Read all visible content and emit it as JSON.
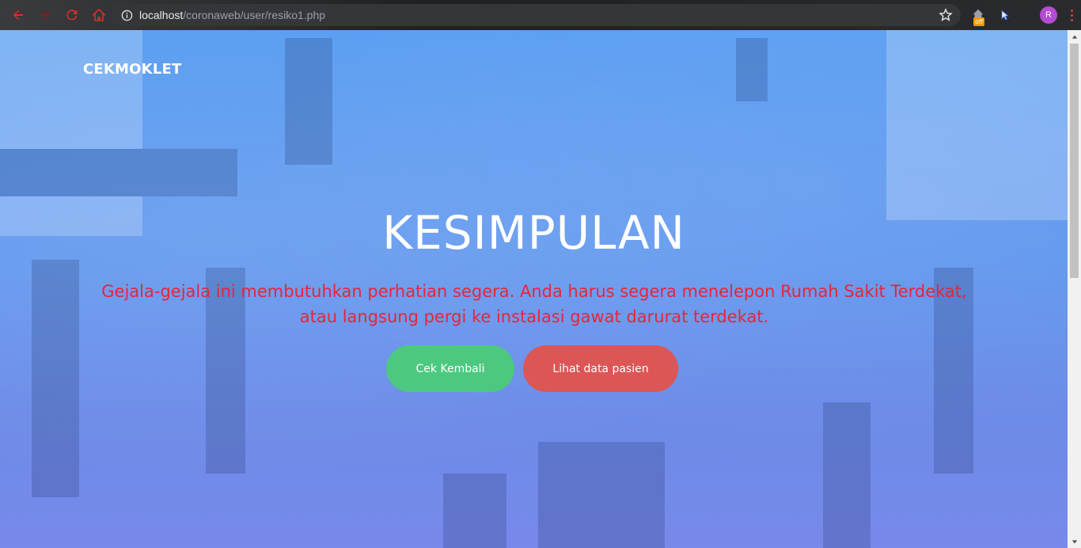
{
  "browser": {
    "url_host": "localhost",
    "url_path": "/coronaweb/user/resiko1.php",
    "extension_badge": "off",
    "avatar_initial": "R",
    "icons": [
      "back-icon",
      "forward-icon",
      "reload-icon",
      "home-icon",
      "info-icon",
      "star-icon",
      "extension-icon",
      "cursor-extension-icon",
      "menu-icon"
    ]
  },
  "page": {
    "brand": "CEKMOKLET",
    "title": "KESIMPULAN",
    "message": "Gejala-gejala ini membutuhkan perhatian segera. Anda harus segera menelepon Rumah Sakit Terdekat, atau langsung pergi ke instalasi gawat darurat terdekat.",
    "buttons": {
      "check_again": "Cek Kembali",
      "view_patients": "Lihat data pasien"
    }
  },
  "colors": {
    "message": "#e8243a",
    "button_green": "#4cc97f",
    "button_red": "#dc5656",
    "background": "#5f9af0"
  }
}
